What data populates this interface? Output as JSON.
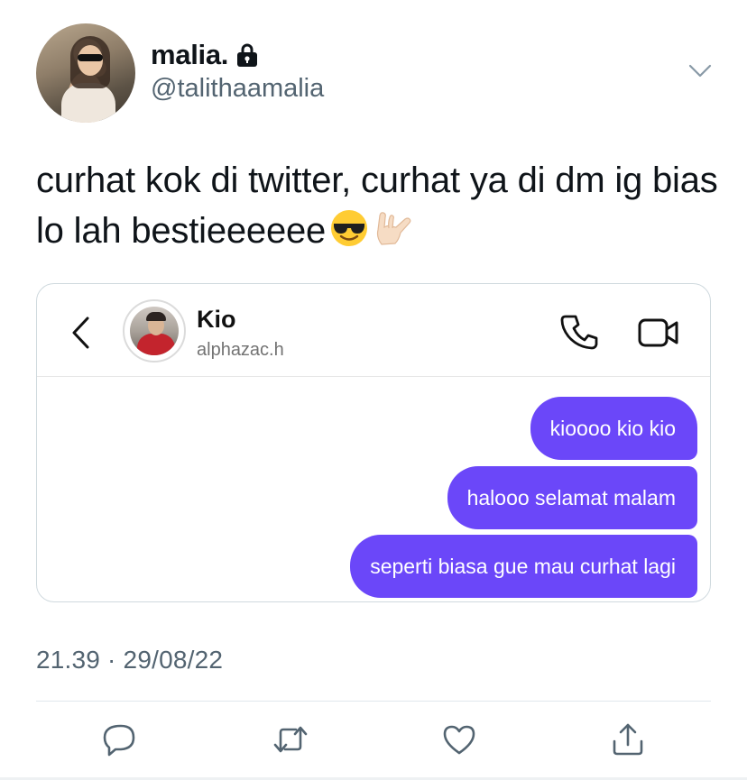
{
  "tweet": {
    "author": {
      "display_name": "malia.",
      "handle": "@talithaamalia",
      "protected_icon": "lock-icon"
    },
    "text": "curhat kok di twitter, curhat ya di dm ig bias lo lah bestieeeeee",
    "emojis": [
      "smiling-face-with-sunglasses-emoji",
      "love-you-gesture-emoji"
    ],
    "timestamp": "21.39 · 29/08/22",
    "actions": [
      "reply-icon",
      "retweet-icon",
      "like-icon",
      "share-icon"
    ]
  },
  "dm": {
    "contact_name": "Kio",
    "contact_username": "alphazac.h",
    "header_icons": [
      "back-icon",
      "phone-icon",
      "video-icon"
    ],
    "bubble_color": "#6b47f9",
    "messages": [
      "kioooo kio kio",
      "halooo selamat malam",
      "seperti biasa gue mau curhat lagi"
    ]
  },
  "colors": {
    "text_primary": "#0f1419",
    "text_secondary": "#536471",
    "border": "#cfd9de"
  }
}
